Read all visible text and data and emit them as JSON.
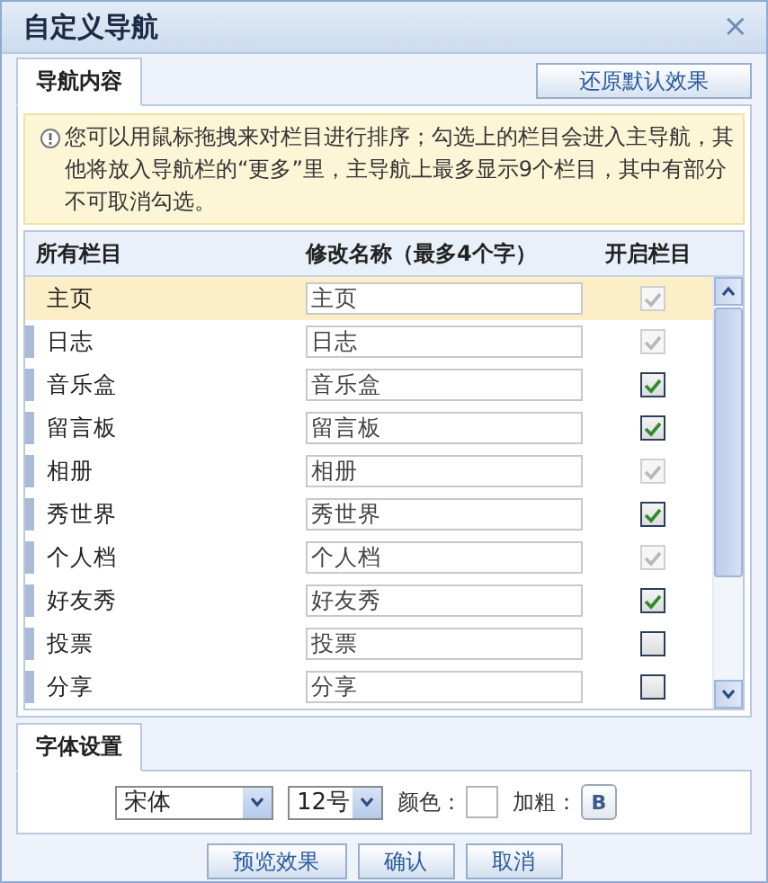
{
  "window": {
    "title": "自定义导航",
    "close": "×"
  },
  "tabs": [
    {
      "label": "导航内容",
      "selected": true
    }
  ],
  "restore_button": "还原默认效果",
  "notice": "您可以用鼠标拖拽来对栏目进行排序；勾选上的栏目会进入主导航，其他将放入导航栏的“更多”里，主导航上最多显示9个栏目，其中有部分不可取消勾选。",
  "table": {
    "columns": [
      "所有栏目",
      "修改名称（最多4个字）",
      "开启栏目"
    ],
    "rows": [
      {
        "name": "主页",
        "value": "主页",
        "checked": true,
        "disabled": true,
        "selected": true
      },
      {
        "name": "日志",
        "value": "日志",
        "checked": true,
        "disabled": true,
        "selected": false
      },
      {
        "name": "音乐盒",
        "value": "音乐盒",
        "checked": true,
        "disabled": false,
        "selected": false
      },
      {
        "name": "留言板",
        "value": "留言板",
        "checked": true,
        "disabled": false,
        "selected": false
      },
      {
        "name": "相册",
        "value": "相册",
        "checked": true,
        "disabled": true,
        "selected": false
      },
      {
        "name": "秀世界",
        "value": "秀世界",
        "checked": true,
        "disabled": false,
        "selected": false
      },
      {
        "name": "个人档",
        "value": "个人档",
        "checked": true,
        "disabled": true,
        "selected": false
      },
      {
        "name": "好友秀",
        "value": "好友秀",
        "checked": true,
        "disabled": false,
        "selected": false
      },
      {
        "name": "投票",
        "value": "投票",
        "checked": false,
        "disabled": false,
        "selected": false
      },
      {
        "name": "分享",
        "value": "分享",
        "checked": false,
        "disabled": false,
        "selected": false
      }
    ]
  },
  "font_tabs": [
    {
      "label": "字体设置",
      "selected": true
    }
  ],
  "font": {
    "family": "宋体",
    "size": "12号",
    "color_label": "颜色：",
    "bold_label": "加粗：",
    "bold_button": "B"
  },
  "buttons": [
    "预览效果",
    "确认",
    "取消"
  ]
}
